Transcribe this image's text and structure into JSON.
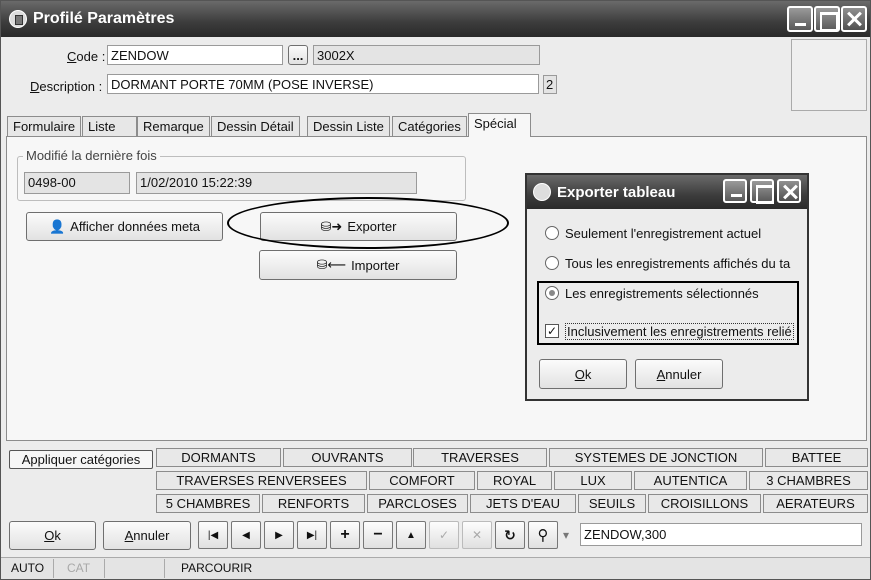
{
  "window": {
    "title": "Profilé Paramètres"
  },
  "form": {
    "code_label_u": "C",
    "code_label_rest": "ode :",
    "code_value": "ZENDOW",
    "browse_label": "...",
    "code_extra": "3002X",
    "desc_label_u": "D",
    "desc_label_rest": "escription :",
    "desc_value": "DORMANT PORTE 70MM (POSE INVERSE)",
    "desc_count": "2"
  },
  "tabs": [
    "Formulaire",
    "Liste",
    "Remarque",
    "Dessin Détail",
    "Dessin Liste",
    "Catégories",
    "Spécial"
  ],
  "special": {
    "group_title": "Modifié la dernière fois",
    "user": "0498-00",
    "date": "1/02/2010 15:22:39",
    "meta_button": "Afficher données meta",
    "export_button": "Exporter",
    "import_button": "Importer"
  },
  "dialog": {
    "title": "Exporter tableau",
    "opt1": "Seulement l'enregistrement actuel",
    "opt2": "Tous les enregistrements affichés du ta",
    "opt3": "Les enregistrements sélectionnés",
    "check": "Inclusivement les enregistrements relié",
    "check_mark": "✓",
    "ok_u": "O",
    "ok_rest": "k",
    "cancel_u": "A",
    "cancel_rest": "nnuler"
  },
  "categories": {
    "apply": "Appliquer catégories",
    "row1": [
      "DORMANTS",
      "OUVRANTS",
      "TRAVERSES",
      "SYSTEMES DE JONCTION",
      "BATTEE"
    ],
    "row2": [
      "TRAVERSES RENVERSEES",
      "COMFORT",
      "ROYAL",
      "LUX",
      "AUTENTICA",
      "3 CHAMBRES"
    ],
    "row3": [
      "5 CHAMBRES",
      "RENFORTS",
      "PARCLOSES",
      "JETS D'EAU",
      "SEUILS",
      "CROISILLONS",
      "AERATEURS"
    ]
  },
  "bottom": {
    "ok_u": "O",
    "ok_rest": "k",
    "cancel_u": "A",
    "cancel_rest": "nnuler",
    "nav": {
      "first": "|◀",
      "prev": "◀",
      "next": "▶",
      "last": "▶|",
      "add": "+",
      "remove": "−",
      "up": "▲",
      "confirm": "✓",
      "cancel": "✕",
      "refresh": "↻",
      "find": "⚲",
      "find_menu": "▾"
    },
    "search_value": "ZENDOW,300"
  },
  "status": {
    "mode": "AUTO",
    "cat": "CAT",
    "action": "PARCOURIR"
  }
}
